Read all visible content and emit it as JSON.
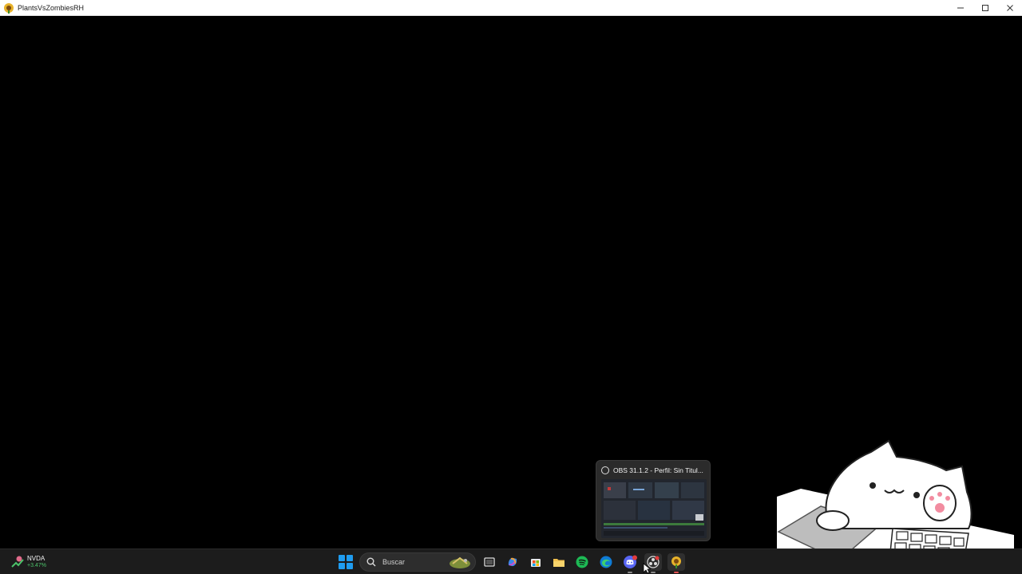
{
  "window": {
    "title": "PlantsVsZombiesRH",
    "controls": [
      "minimize",
      "maximize",
      "close"
    ]
  },
  "preview": {
    "title": "OBS 31.1.2 - Perfil: Sin Titul..."
  },
  "widget": {
    "ticker": "NVDA",
    "change": "+3.47%"
  },
  "taskbar": {
    "search_placeholder": "Buscar",
    "apps": [
      {
        "name": "task-view"
      },
      {
        "name": "copilot"
      },
      {
        "name": "microsoft-store"
      },
      {
        "name": "file-explorer"
      },
      {
        "name": "spotify"
      },
      {
        "name": "edge"
      },
      {
        "name": "discord",
        "badge": "99"
      },
      {
        "name": "obs"
      },
      {
        "name": "plants-vs-zombies"
      }
    ]
  },
  "colors": {
    "accent": "#1f9cf0",
    "taskbar": "#1c1c1c",
    "spotify": "#1db954",
    "discord": "#5865f2"
  }
}
